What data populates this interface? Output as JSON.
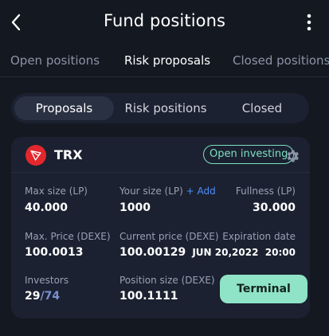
{
  "header": {
    "title": "Fund positions",
    "back_icon": "chevron-left-icon",
    "menu_icon": "kebab-menu-icon"
  },
  "top_tabs": [
    {
      "label": "Open positions",
      "active": false
    },
    {
      "label": "Risk proposals",
      "active": true
    },
    {
      "label": "Closed positions",
      "active": false
    }
  ],
  "segment_tabs": [
    {
      "label": "Proposals",
      "active": true
    },
    {
      "label": "Risk positions",
      "active": false
    },
    {
      "label": "Closed",
      "active": false
    }
  ],
  "card": {
    "token": {
      "name": "TRX",
      "icon": "tron-logo-icon",
      "icon_color": "#e3272d"
    },
    "status_badge": "Open investing",
    "settings_icon": "gear-icon",
    "max_size": {
      "label": "Max size (LP)",
      "value": "40.000"
    },
    "your_size": {
      "label": "Your size (LP)",
      "add_label": "+ Add",
      "value": "1000"
    },
    "fullness": {
      "label": "Fullness (LP)",
      "value": "30.000"
    },
    "max_price": {
      "label": "Max. Price (DEXE)",
      "value": "100.0013"
    },
    "current_price": {
      "label": "Current price (DEXE)",
      "value": "100.00129"
    },
    "expiration": {
      "label": "Expiration date",
      "date": "JUN 20,2022",
      "time": "20:00"
    },
    "investors": {
      "label": "Investors",
      "current": "29",
      "separator": "/",
      "total": "74"
    },
    "position_size": {
      "label": "Position size (DEXE)",
      "value": "100.1111"
    },
    "terminal_button": "Terminal"
  },
  "colors": {
    "background": "#141821",
    "card": "#1b2130",
    "accent_green": "#8fe3c6",
    "link_blue": "#4d8dff"
  }
}
